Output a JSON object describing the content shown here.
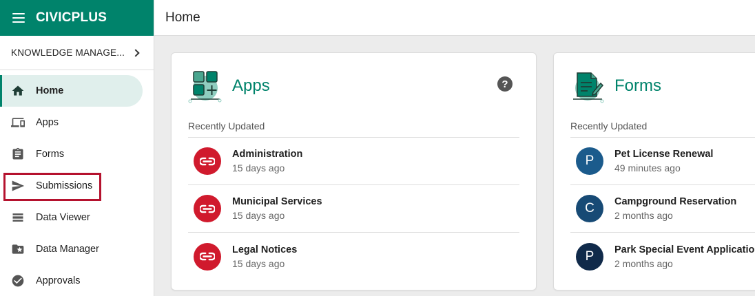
{
  "brand": {
    "name": "CIVICPLUS",
    "color": "#00836b"
  },
  "header": {
    "title": "Home"
  },
  "sidebar": {
    "section_label": "KNOWLEDGE MANAGE...",
    "items": [
      {
        "label": "Home",
        "icon": "home-icon",
        "active": true
      },
      {
        "label": "Apps",
        "icon": "devices-icon"
      },
      {
        "label": "Forms",
        "icon": "clipboard-icon"
      },
      {
        "label": "Submissions",
        "icon": "send-icon",
        "highlighted": true
      },
      {
        "label": "Data Viewer",
        "icon": "table-rows-icon"
      },
      {
        "label": "Data Manager",
        "icon": "folder-star-icon"
      },
      {
        "label": "Approvals",
        "icon": "check-circle-icon"
      }
    ]
  },
  "apps_card": {
    "title": "Apps",
    "recent_label": "Recently Updated",
    "items": [
      {
        "name": "Administration",
        "time": "15 days ago",
        "icon": "civicplus-logo-icon"
      },
      {
        "name": "Municipal Services",
        "time": "15 days ago",
        "icon": "civicplus-logo-icon"
      },
      {
        "name": "Legal Notices",
        "time": "15 days ago",
        "icon": "civicplus-logo-icon"
      }
    ]
  },
  "forms_card": {
    "title": "Forms",
    "recent_label": "Recently Updated",
    "items": [
      {
        "name": "Pet License Renewal",
        "time": "49 minutes ago",
        "initial": "P",
        "color": "#1b5b8c"
      },
      {
        "name": "Campground Reservation",
        "time": "2 months ago",
        "initial": "C",
        "color": "#174a75"
      },
      {
        "name": "Park Special Event Application",
        "time": "2 months ago",
        "initial": "P",
        "color": "#102a4a"
      }
    ]
  },
  "colors": {
    "accent": "#00836b",
    "active_bg": "#e0efec",
    "highlight": "#b5122e",
    "civicplus_red": "#d01a2d"
  }
}
